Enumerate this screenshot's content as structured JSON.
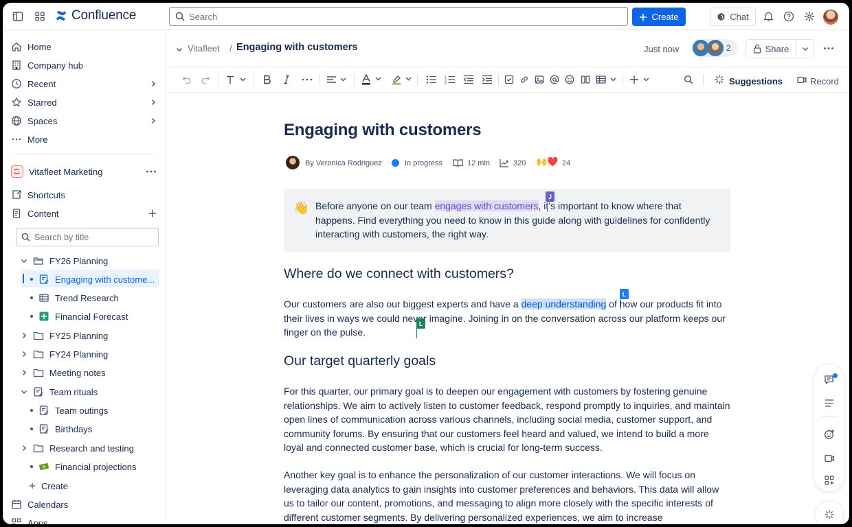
{
  "topnav": {
    "app_name": "Confluence",
    "search_placeholder": "Search",
    "create_label": "Create",
    "chat_label": "Chat"
  },
  "sidebar": {
    "items": [
      {
        "label": "Home",
        "icon": "home-icon"
      },
      {
        "label": "Company hub",
        "icon": "building-icon"
      },
      {
        "label": "Recent",
        "icon": "clock-icon"
      },
      {
        "label": "Starred",
        "icon": "star-icon"
      },
      {
        "label": "Spaces",
        "icon": "globe-icon"
      },
      {
        "label": "More",
        "icon": "more-icon"
      }
    ],
    "space_name": "Vitafleet Marketing",
    "shortcuts_label": "Shortcuts",
    "content_label": "Content",
    "search_placeholder": "Search by title",
    "tree": [
      {
        "label": "FY26 Planning",
        "icon": "folder-open-icon"
      },
      {
        "label": "Engaging with custome...",
        "icon": "page-edit-icon",
        "active": true
      },
      {
        "label": "Trend Research",
        "icon": "table-icon"
      },
      {
        "label": "Financial Forecast",
        "icon": "sheet-icon"
      },
      {
        "label": "FY25 Planning",
        "icon": "folder-icon"
      },
      {
        "label": "FY24 Planning",
        "icon": "folder-icon"
      },
      {
        "label": "Meeting notes",
        "icon": "folder-icon"
      },
      {
        "label": "Team rituals",
        "icon": "page-edit-icon"
      },
      {
        "label": "Team outings",
        "icon": "page-edit-icon"
      },
      {
        "label": "Birthdays",
        "icon": "page-edit-icon"
      },
      {
        "label": "Research and testing",
        "icon": "folder-icon"
      },
      {
        "label": "Financial projections",
        "icon": "money-icon"
      }
    ],
    "create_label": "Create",
    "calendars_label": "Calendars",
    "apps_label": "Apps"
  },
  "page_header": {
    "breadcrumb": "Vitafleet",
    "separator": "/",
    "title": "Engaging with customers",
    "saved": "Just now",
    "collaborator_count": "2",
    "share_label": "Share"
  },
  "toolbar": {
    "suggestions_label": "Suggestions",
    "record_label": "Record"
  },
  "document": {
    "title": "Engaging with customers",
    "author": "By Veronica Rodriguez",
    "status": "In progress",
    "read_time": "12 min",
    "views": "320",
    "reactions": "24",
    "reaction_emoji": "🙌❤️",
    "panel": {
      "emoji": "👋",
      "before": "Before anyone on our team ",
      "highlight": "engages with customers",
      "after": ", it’s important to know where that happens. Find everything you need to know in this guide along with guidelines for confidently interacting with customers, the right way.",
      "cursor_tag": "J"
    },
    "h2_connect": "Where do we connect with customers?",
    "connect_para": {
      "before": "Our customers are also our biggest experts and have a ",
      "highlight": "deep understanding",
      "after": " of how our products fit into their lives in ways we could never imagine. Joining in on the conversation across our platform keeps our finger on the pulse.",
      "cursor_tag_1": "L",
      "cursor_tag_2": "L"
    },
    "h2_goals": "Our target quarterly goals",
    "goals_para_1": "For this quarter, our primary goal is to deepen our engagement with customers by fostering genuine relationships. We aim to actively listen to customer feedback, respond promptly to inquiries, and maintain open lines of communication across various channels, including social media, customer support, and community forums. By ensuring that our customers feel heard and valued, we intend to build a more loyal and connected customer base, which is crucial for long-term success.",
    "goals_para_2": "Another key goal is to enhance the personalization of our customer interactions. We will focus on leveraging data analytics to gain insights into customer preferences and behaviors. This data will allow us to tailor our content, promotions, and messaging to align more closely with the specific interests of different customer segments. By delivering personalized experiences, we aim to increase"
  },
  "colors": {
    "brand_blue": "#0c66e4",
    "highlight_purple": "#dfd8fd",
    "highlight_blue": "#cce0ff",
    "cursor_purple": "#6e5dc6",
    "cursor_blue": "#1d7afc",
    "cursor_green": "#1f845a"
  }
}
